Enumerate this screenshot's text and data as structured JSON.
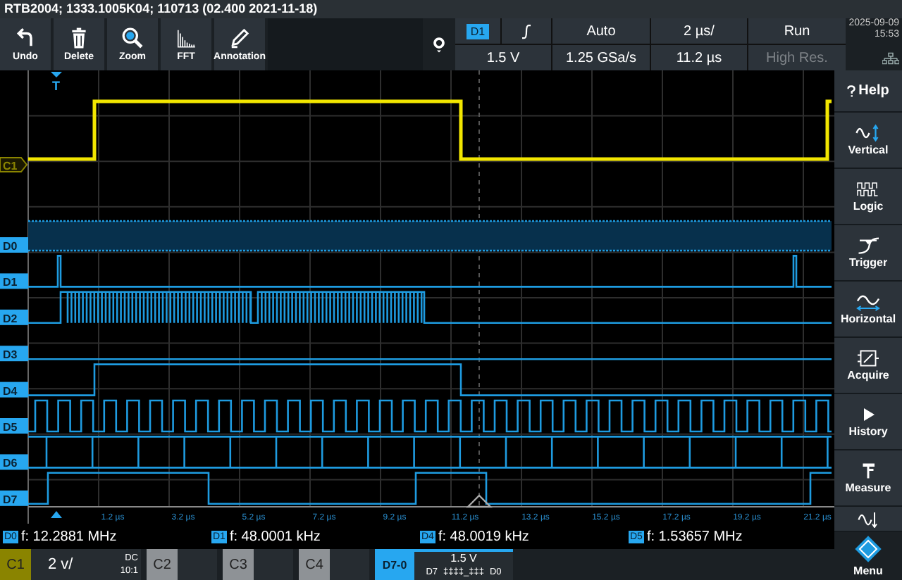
{
  "title_bar": "RTB2004; 1333.1005K04; 110713 (02.400 2021-11-18)",
  "toolbar": [
    {
      "label": "Undo"
    },
    {
      "label": "Delete"
    },
    {
      "label": "Zoom"
    },
    {
      "label": "FFT"
    },
    {
      "label": "Annotation"
    }
  ],
  "settings": {
    "source": "D1",
    "mode": "Auto",
    "timebase": "2 µs/",
    "run_state": "Run",
    "trigger_level": "1.5 V",
    "sample_rate": "1.25 GSa/s",
    "position": "11.2 µs",
    "acquisition": {
      "label": "High Res.",
      "disabled": true
    }
  },
  "clock": {
    "date": "2025-09-09",
    "time": "15:53"
  },
  "trigger_marker": "T",
  "lanes": [
    {
      "label": "C1",
      "kind": "analog"
    },
    {
      "label": "D0",
      "kind": "digital"
    },
    {
      "label": "D1",
      "kind": "digital"
    },
    {
      "label": "D2",
      "kind": "digital"
    },
    {
      "label": "D3",
      "kind": "digital"
    },
    {
      "label": "D4",
      "kind": "digital"
    },
    {
      "label": "D5",
      "kind": "digital"
    },
    {
      "label": "D6",
      "kind": "digital"
    },
    {
      "label": "D7",
      "kind": "digital"
    }
  ],
  "time_ticks": [
    "1.2 µs",
    "3.2 µs",
    "5.2 µs",
    "7.2 µs",
    "9.2 µs",
    "11.2 µs",
    "13.2 µs",
    "15.2 µs",
    "17.2 µs",
    "19.2 µs",
    "21.2 µs"
  ],
  "measurements": [
    {
      "source": "D0",
      "text": "f: 12.2881 MHz"
    },
    {
      "source": "D1",
      "text": "f: 48.0001 kHz"
    },
    {
      "source": "D4",
      "text": "f: 48.0019 kHz"
    },
    {
      "source": "D5",
      "text": "f: 1.53657 MHz"
    }
  ],
  "channels": [
    {
      "label": "C1",
      "kind": "analog",
      "on": true,
      "scale": "2 v/",
      "coupling": "DC",
      "probe": "10:1"
    },
    {
      "label": "C2",
      "kind": "analog",
      "on": false
    },
    {
      "label": "C3",
      "kind": "analog",
      "on": false
    },
    {
      "label": "C4",
      "kind": "analog",
      "on": false
    },
    {
      "label": "D7-0",
      "kind": "digital",
      "on": true,
      "threshold": "1.5 V",
      "msb": "D7",
      "bits": "‡‡‡‡_‡‡‡",
      "lsb": "D0"
    }
  ],
  "sidebar": [
    {
      "label": "Help"
    },
    {
      "label": "Vertical"
    },
    {
      "label": "Logic"
    },
    {
      "label": "Trigger"
    },
    {
      "label": "Horizontal"
    },
    {
      "label": "Acquire"
    },
    {
      "label": "History"
    },
    {
      "label": "Measure"
    },
    {
      "label": "Menu"
    }
  ]
}
